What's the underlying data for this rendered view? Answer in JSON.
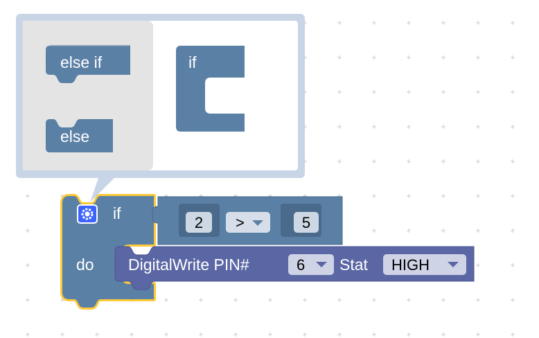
{
  "mutator_flyout": {
    "else_if_label": "else if",
    "else_label": "else",
    "if_label": "if"
  },
  "if_block": {
    "if_label": "if",
    "do_label": "do",
    "condition": {
      "left_value": "2",
      "operator": ">",
      "right_value": "5"
    }
  },
  "digital_write_block": {
    "label": "DigitalWrite PIN#",
    "pin_value": "6",
    "stat_label": "Stat",
    "stat_value": "HIGH"
  },
  "icons": [
    "gear-icon",
    "dropdown-arrow-icon"
  ],
  "colors": {
    "logic_block": "#5b80a5",
    "compare_block": "#5b80a5",
    "io_block": "#5b67a5",
    "selection_outline": "#fcc938",
    "mutator_bubble_border": "#c8d5e6",
    "flyout_background": "#e4e4e4"
  }
}
